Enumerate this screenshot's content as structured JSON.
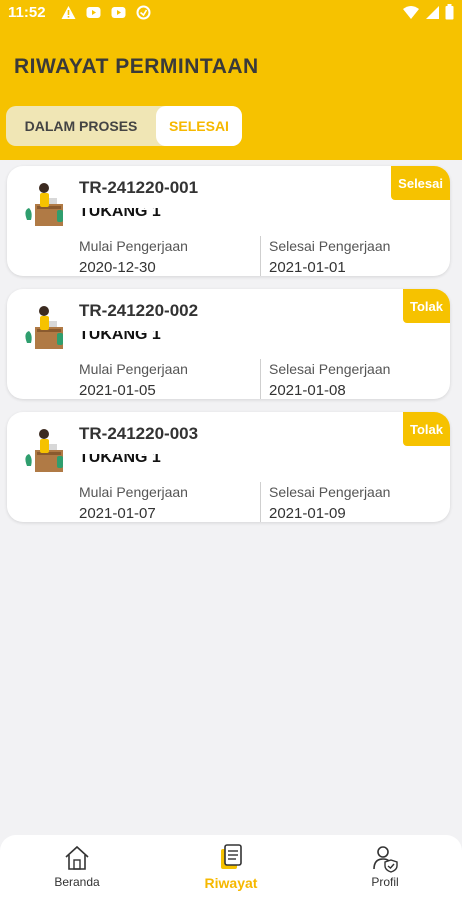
{
  "status_bar": {
    "time": "11:52",
    "notification_icons": [
      "alert-icon",
      "youtube-icon",
      "youtube-icon",
      "sync-icon"
    ],
    "right_icons": [
      "wifi-icon",
      "signal-icon",
      "battery-icon"
    ]
  },
  "page": {
    "title": "RIWAYAT PERMINTAAN"
  },
  "tabs": [
    {
      "label": "DALAM PROSES",
      "active": false
    },
    {
      "label": "SELESAI",
      "active": true
    }
  ],
  "colors": {
    "accent": "#f6c200",
    "background": "#f2f2f4"
  },
  "requests": [
    {
      "code": "TR-241220-001",
      "worker": "TUKANG 1",
      "status": "Selesai",
      "start_label": "Mulai Pengerjaan",
      "start_date": "2020-12-30",
      "end_label": "Selesai Pengerjaan",
      "end_date": "2021-01-01"
    },
    {
      "code": "TR-241220-002",
      "worker": "TUKANG 1",
      "status": "Tolak",
      "start_label": "Mulai Pengerjaan",
      "start_date": "2021-01-05",
      "end_label": "Selesai Pengerjaan",
      "end_date": "2021-01-08"
    },
    {
      "code": "TR-241220-003",
      "worker": "TUKANG 1",
      "status": "Tolak",
      "start_label": "Mulai Pengerjaan",
      "start_date": "2021-01-07",
      "end_label": "Selesai Pengerjaan",
      "end_date": "2021-01-09"
    }
  ],
  "bottom_nav": [
    {
      "label": "Beranda",
      "icon": "home-icon",
      "active": false
    },
    {
      "label": "Riwayat",
      "icon": "document-icon",
      "active": true
    },
    {
      "label": "Profil",
      "icon": "profile-shield-icon",
      "active": false
    }
  ]
}
